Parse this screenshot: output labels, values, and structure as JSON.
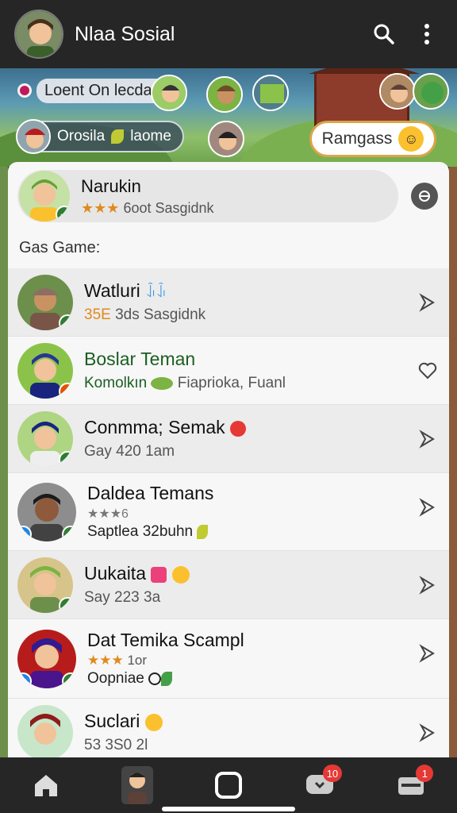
{
  "app": {
    "title": "Nlaa Sosial"
  },
  "banner": {
    "online_label": "Loent On lecdaa",
    "group_label": "Orosila",
    "group_label_suffix": "laome",
    "rangs_button": "Ramgass"
  },
  "me": {
    "name": "Narukin",
    "stars": "★★★",
    "sub_a": "6oot",
    "sub_b": "Sasgidnk"
  },
  "section": {
    "title": "Gas Game:"
  },
  "friends": [
    {
      "name": "Watluri",
      "name_tag": "ꀭꀭ",
      "sub_orange": "35E",
      "sub": "3ds Sasgidnk"
    },
    {
      "name": "Boslar Teman",
      "sub_green": "Komolkın",
      "sub": "Fiaprioka, Fuanl"
    },
    {
      "name": "Conmma; Semak",
      "sub": "Gay 420 1am"
    },
    {
      "name": "Daldea Temans",
      "stars": "★★★6",
      "sub": "Saptlea 32buhn"
    },
    {
      "name": "Uukaita",
      "sub": "Say 223 3a"
    },
    {
      "name": "Dat Temika Scampl",
      "stars": "★★★",
      "stars_extra": "1or",
      "sub": "Oopniae"
    },
    {
      "name": "Suclari",
      "sub": "53 3S0 2l"
    }
  ],
  "nav": {
    "messages_count": "10",
    "notifications_count": "1"
  },
  "colors": {
    "accent": "#2e7d32",
    "bar": "#262626",
    "badge": "#e53935"
  },
  "icons": [
    "search-icon",
    "more-vert-icon",
    "home-icon",
    "profile-icon",
    "square-icon",
    "chat-icon",
    "inbox-icon",
    "chevron-right-icon",
    "heart-icon",
    "check-icon"
  ]
}
